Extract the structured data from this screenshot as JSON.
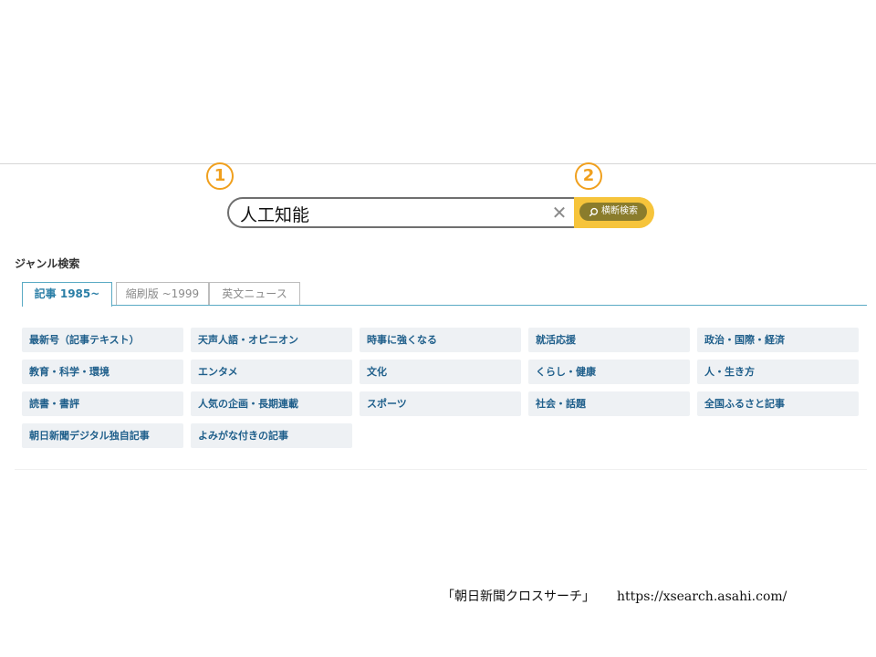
{
  "markers": {
    "one": "1",
    "two": "2"
  },
  "search": {
    "value": "人工知能",
    "button_label": "横断検索"
  },
  "genre_title": "ジャンル検索",
  "tabs": [
    {
      "label": "記事 1985~",
      "active": true
    },
    {
      "label": "縮刷版 ~1999",
      "active": false
    },
    {
      "label": "英文ニュース",
      "active": false
    }
  ],
  "categories": [
    "最新号（記事テキスト）",
    "天声人語・オピニオン",
    "時事に強くなる",
    "就活応援",
    "政治・国際・経済",
    "教育・科学・環境",
    "エンタメ",
    "文化",
    "くらし・健康",
    "人・生き方",
    "読書・書評",
    "人気の企画・長期連載",
    "スポーツ",
    "社会・話題",
    "全国ふるさと記事",
    "朝日新聞デジタル独自記事",
    "よみがな付きの記事"
  ],
  "source": {
    "name": "「朝日新聞クロスサーチ」",
    "url": "https://xsearch.asahi.com/"
  },
  "colors": {
    "accent": "#f0a01e",
    "button": "#f6c43b",
    "tab": "#2a7ea6",
    "category_text": "#1f5f8b"
  }
}
